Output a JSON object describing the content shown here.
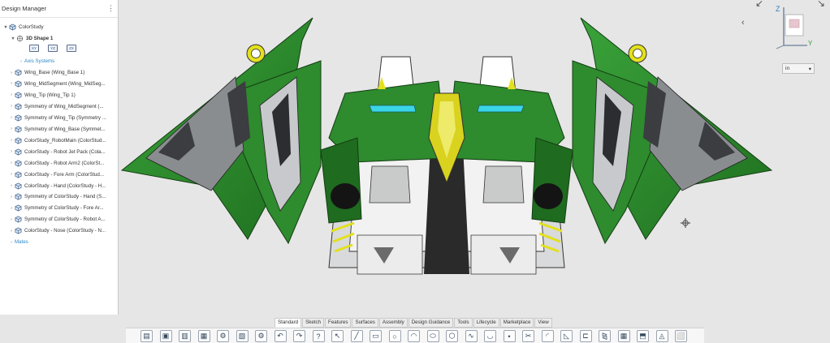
{
  "design_manager": {
    "title": "Design Manager",
    "menu_icon": "vertical-dots-icon",
    "root": "ColorStudy",
    "shape": "3D Shape 1",
    "axis_systems": "Axis Systems",
    "items": [
      "Wing_Base (Wing_Base 1)",
      "Wing_MidSegment (Wing_MidSeg...",
      "Wing_Tip (Wing_Tip 1)",
      "Symmetry of Wing_MidSegment (...",
      "Symmetry of Wing_Tip (Symmetry ...",
      "Symmetry of Wing_Base (Symmet...",
      "ColorStudy_RobotMain (ColorStud...",
      "ColorStudy - Robot Jet Pack (Cola...",
      "ColorStudy - Robot Arm2 (ColorSt...",
      "ColorStudy - Fore Arm (ColorStud...",
      "ColorStudy - Hand (ColorStudy - H...",
      "Symmetry of ColorStudy - Hand (S...",
      "Symmetry of ColorStudy - Fore Ar...",
      "Symmetry of ColorStudy - Robot A...",
      "ColorStudy - Nose (ColorStudy - N..."
    ],
    "mates": "Mates"
  },
  "viewport": {
    "unit": "in",
    "orientation": {
      "z_label": "Z",
      "y_label": "Y"
    }
  },
  "ribbon_tabs": [
    "Standard",
    "Sketch",
    "Features",
    "Surfaces",
    "Assembly",
    "Design Guidance",
    "Tools",
    "Lifecycle",
    "Marketplace",
    "View"
  ],
  "active_tab": "Standard",
  "toolbar_icons": [
    "new",
    "open",
    "save",
    "save-all",
    "settings",
    "screenshot",
    "options",
    "undo",
    "redo",
    "help",
    "select",
    "line",
    "rectangle",
    "circle",
    "arc",
    "ellipse",
    "polygon",
    "spline",
    "conic",
    "point",
    "trim",
    "fillet",
    "chamfer",
    "offset",
    "mirror",
    "pattern",
    "extrude",
    "revolve",
    "shell"
  ],
  "colors": {
    "model_green": "#2e8b2e",
    "model_green_dark": "#1f6b1f",
    "model_yellow": "#d9d21e",
    "link_blue": "#2f86c4"
  }
}
